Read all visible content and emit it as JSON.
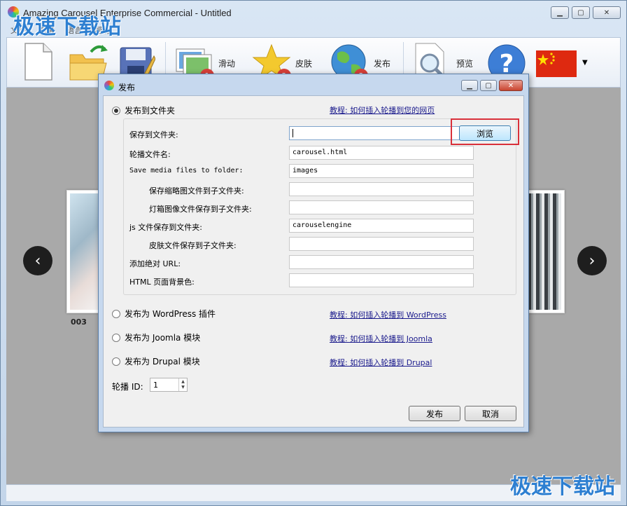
{
  "window": {
    "title": "Amazing Carousel Enterprise Commercial - Untitled",
    "watermark": "极速下载站",
    "menu": [
      "文件",
      "编辑",
      "语言",
      "帮助"
    ]
  },
  "toolbar": {
    "slide_label": "滑动",
    "skin_label": "皮肤",
    "publish_label": "发布",
    "preview_label": "预览"
  },
  "carousel": {
    "caption_left": "003"
  },
  "dialog": {
    "title": "发布",
    "folder_option": "发布到文件夹",
    "folder_tutorial": "教程: 如何插入轮播到您的网页",
    "fields": {
      "save_folder_label": "保存到文件夹:",
      "save_folder_value": "",
      "filename_label": "轮播文件名:",
      "filename_value": "carousel.html",
      "media_label": "Save media files to folder:",
      "media_value": "images",
      "thumb_label": "保存缩略图文件到子文件夹:",
      "thumb_value": "",
      "lightbox_label": "灯箱图像文件保存到子文件夹:",
      "lightbox_value": "",
      "js_label": "js 文件保存到文件夹:",
      "js_value": "carouselengine",
      "skin_label": "皮肤文件保存到子文件夹:",
      "skin_value": "",
      "url_label": "添加绝对 URL:",
      "url_value": "",
      "bg_label": "HTML 页面背景色:",
      "bg_value": ""
    },
    "browse_button": "浏览",
    "wordpress_option": "发布为 WordPress 插件",
    "wordpress_tutorial": "教程: 如何插入轮播到 WordPress",
    "joomla_option": "发布为 Joomla 模块",
    "joomla_tutorial": "教程: 如何插入轮播到 Joomla",
    "drupal_option": "发布为 Drupal 模块",
    "drupal_tutorial": "教程: 如何插入轮播到 Drupal",
    "carousel_id_label": "轮播 ID:",
    "carousel_id_value": "1",
    "publish_button": "发布",
    "cancel_button": "取消"
  },
  "colors": {
    "highlight": "#d9303a",
    "link": "#1a1a8c"
  }
}
